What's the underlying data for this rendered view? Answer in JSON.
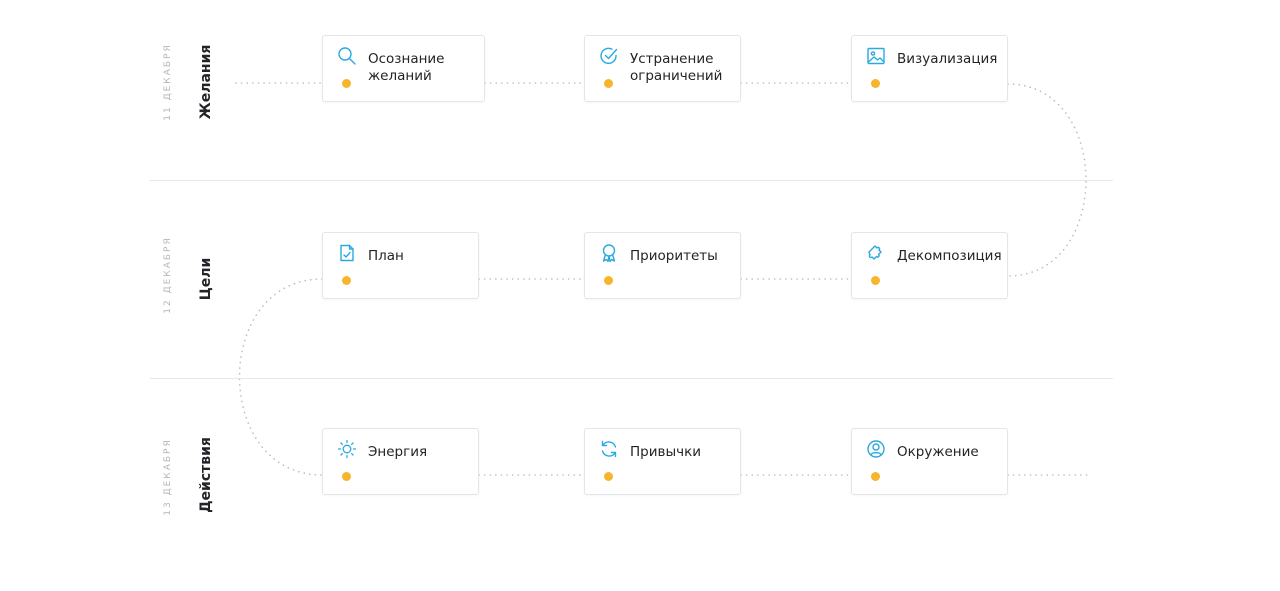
{
  "accent_color": "#f7b52c",
  "icon_color": "#2aa9e0",
  "rows": [
    {
      "date": "11 ДЕКАБРЯ",
      "title": "Желания",
      "steps": [
        {
          "label": "Осознание\nжеланий",
          "icon": "search-icon"
        },
        {
          "label": "Устранение\nограничений",
          "icon": "check-circle-icon"
        },
        {
          "label": "Визуализация",
          "icon": "image-icon"
        }
      ]
    },
    {
      "date": "12 ДЕКАБРЯ",
      "title": "Цели",
      "steps": [
        {
          "label": "План",
          "icon": "document-icon"
        },
        {
          "label": "Приоритеты",
          "icon": "award-icon"
        },
        {
          "label": "Декомпозиция",
          "icon": "puzzle-icon"
        }
      ]
    },
    {
      "date": "13 ДЕКАБРЯ",
      "title": "Действия",
      "steps": [
        {
          "label": "Энергия",
          "icon": "sun-icon"
        },
        {
          "label": "Привычки",
          "icon": "refresh-icon"
        },
        {
          "label": "Окружение",
          "icon": "user-circle-icon"
        }
      ]
    }
  ]
}
